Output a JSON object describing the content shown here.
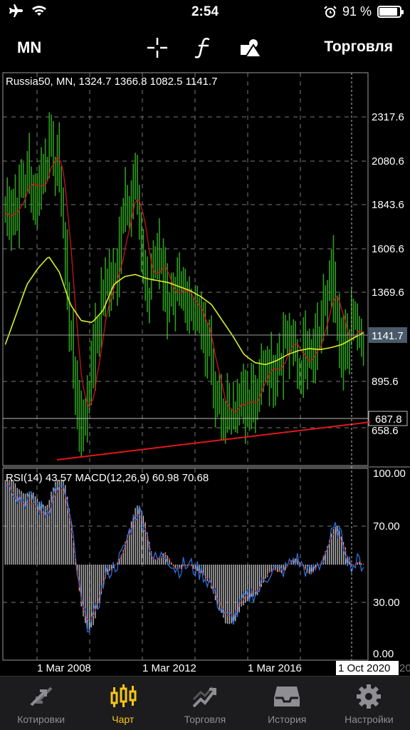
{
  "status_bar": {
    "time": "2:54",
    "battery": "91 %",
    "battery_level": 0.91
  },
  "toolbar": {
    "timeframe": "MN",
    "trade_label": "Торговля"
  },
  "chart": {
    "info_line": "Russia50, MN, 1324.7 1366.8 1082.5 1141.7",
    "price_ticks": [
      "2317.6",
      "2080.6",
      "1843.6",
      "1606.6",
      "1369.6",
      "895.6"
    ],
    "current_price": "1141.7",
    "line_price": "687.8",
    "hidden_tick": "658.6",
    "indicator_line": "RSI(14) 43.57 MACD(12,26,9) 60.98 70.68",
    "indicator_ticks": [
      "100.00",
      "70.00",
      "30.00",
      "0.00"
    ],
    "time_ticks": [
      "1 Mar 2008",
      "1 Mar 2012",
      "1 Mar 2016"
    ],
    "cursor_time": "1 Oct 2020",
    "cursor_suffix": "20",
    "colors": {
      "candles": "#2f9e1e",
      "ma_fast": "#c8141e",
      "ma_slow": "#d8f028",
      "rsi": "#2d6fd8",
      "macd_signal": "#c81e1e",
      "trendline": "#e01818"
    }
  },
  "tabs": [
    {
      "label": "Котировки",
      "icon": "quotes-icon"
    },
    {
      "label": "Чарт",
      "icon": "chart-icon"
    },
    {
      "label": "Торговля",
      "icon": "trade-icon"
    },
    {
      "label": "История",
      "icon": "history-icon"
    },
    {
      "label": "Настройки",
      "icon": "settings-icon"
    }
  ],
  "active_tab": 1,
  "chart_data": {
    "type": "candlestick",
    "symbol": "Russia50",
    "timeframe": "MN",
    "x": [
      "2006-01",
      "2006-07",
      "2007-01",
      "2007-07",
      "2008-01",
      "2008-05",
      "2008-09",
      "2009-01",
      "2009-07",
      "2010-01",
      "2010-07",
      "2011-01",
      "2011-04",
      "2011-10",
      "2012-03",
      "2012-09",
      "2013-03",
      "2013-09",
      "2014-03",
      "2014-09",
      "2015-01",
      "2015-06",
      "2016-01",
      "2016-06",
      "2017-01",
      "2017-06",
      "2018-01",
      "2018-06",
      "2019-01",
      "2019-06",
      "2020-01",
      "2020-03",
      "2020-06",
      "2020-10"
    ],
    "close": [
      1850,
      1900,
      2050,
      1950,
      2200,
      2050,
      1200,
      780,
      1100,
      1460,
      1580,
      1850,
      2000,
      1450,
      1600,
      1450,
      1500,
      1420,
      1320,
      1100,
      800,
      950,
      900,
      980,
      1150,
      1080,
      1250,
      1100,
      1200,
      1250,
      1560,
      1100,
      1300,
      1141.7
    ],
    "ma_slow": [
      1200,
      1350,
      1500,
      1580,
      1640,
      1560,
      1400,
      1320,
      1310,
      1370,
      1500,
      1540,
      1550,
      1530,
      1520,
      1510,
      1490,
      1470,
      1440,
      1400,
      1320,
      1240,
      1150,
      1110,
      1100,
      1120,
      1150,
      1170,
      1180,
      1175,
      1185,
      1200,
      1230,
      1260
    ],
    "ylim": [
      600,
      2550
    ],
    "rsi": {
      "last": 43.57,
      "ylim": [
        0,
        100
      ]
    },
    "macd": {
      "main": 60.98,
      "signal": 70.68
    }
  }
}
